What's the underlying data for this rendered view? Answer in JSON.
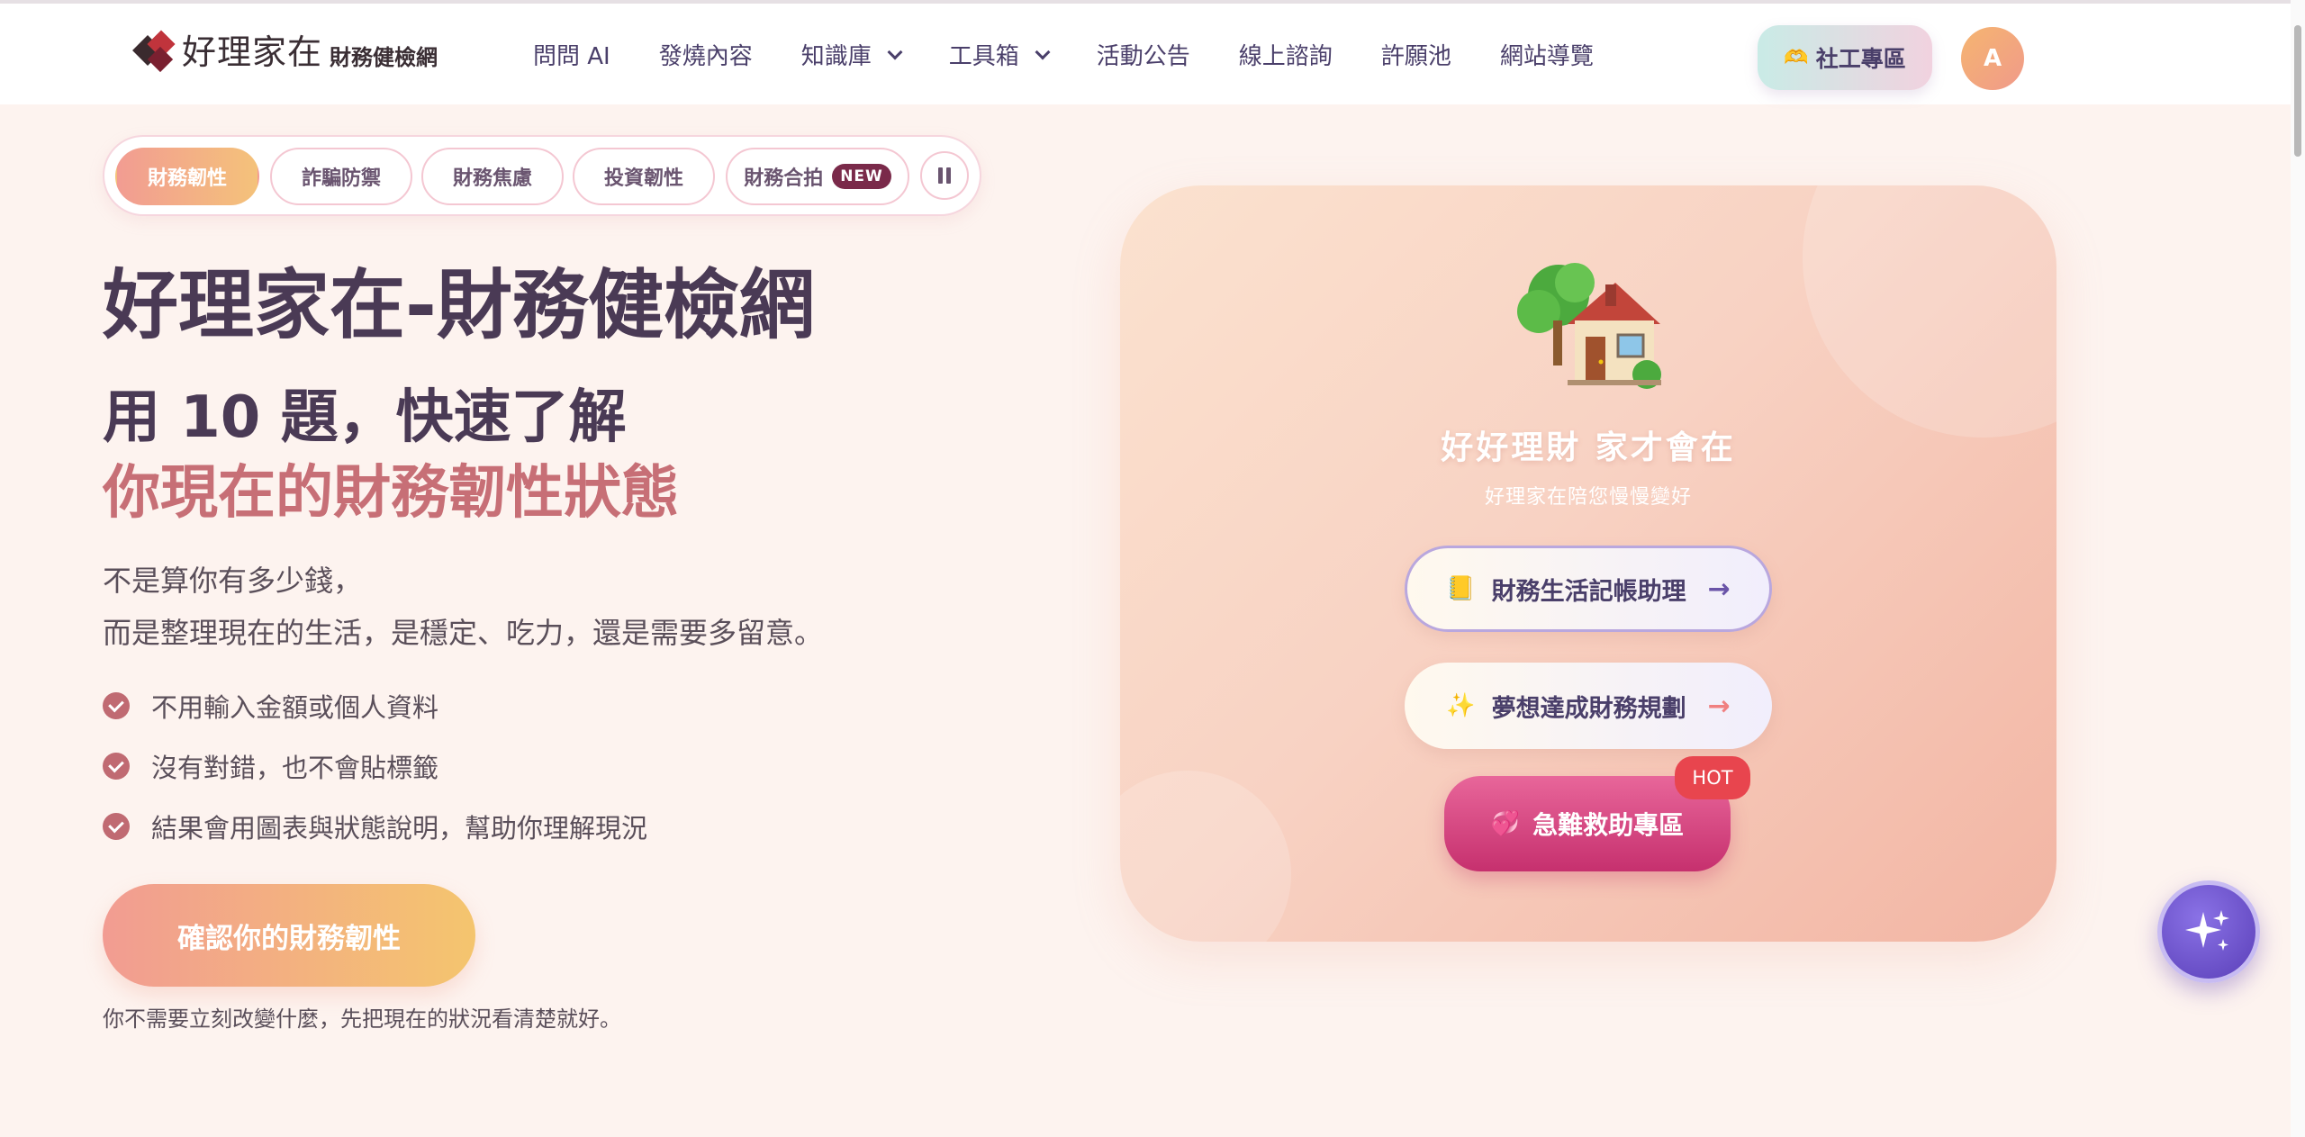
{
  "header": {
    "logo_main": "好理家在",
    "logo_sub": "財務健檢網",
    "nav": [
      {
        "label": "問問 AI"
      },
      {
        "label": "發燒內容"
      },
      {
        "label": "知識庫"
      },
      {
        "label": "工具箱"
      },
      {
        "label": "活動公告"
      },
      {
        "label": "線上諮詢"
      },
      {
        "label": "許願池"
      },
      {
        "label": "網站導覽"
      }
    ],
    "social_label": "社工專區",
    "avatar_letter": "A"
  },
  "tabs": {
    "items": [
      {
        "label": "財務韌性",
        "active": true
      },
      {
        "label": "詐騙防禦"
      },
      {
        "label": "財務焦慮"
      },
      {
        "label": "投資韌性"
      },
      {
        "label": "財務合拍",
        "badge": "NEW"
      }
    ]
  },
  "hero": {
    "title": "好理家在-財務健檢網",
    "subtitle_line1": "用 10 題，快速了解",
    "subtitle_line2": "你現在的財務韌性狀態",
    "desc_line1": "不是算你有多少錢，",
    "desc_line2": "而是整理現在的生活，是穩定、吃力，還是需要多留意。",
    "checklist": [
      "不用輸入金額或個人資料",
      "沒有對錯，也不會貼標籤",
      "結果會用圖表與狀態說明，幫助你理解現況"
    ],
    "cta_label": "確認你的財務韌性",
    "footnote": "你不需要立刻改變什麼，先把現在的狀況看清楚就好。"
  },
  "card": {
    "title": "好好理財 家才會在",
    "subtitle": "好理家在陪您慢慢變好",
    "btn1_label": "財務生活記帳助理",
    "btn1_icon": "📒",
    "btn2_label": "夢想達成財務規劃",
    "btn2_icon": "✨",
    "urgent_label": "急難救助專區",
    "urgent_icon": "💞",
    "hot_badge": "HOT"
  },
  "colors": {
    "accent_pink": "#c76f76",
    "cta_start": "#f29c92",
    "cta_end": "#f4c56e",
    "urgent": "#c6306e",
    "fab": "#5a3fb8"
  }
}
